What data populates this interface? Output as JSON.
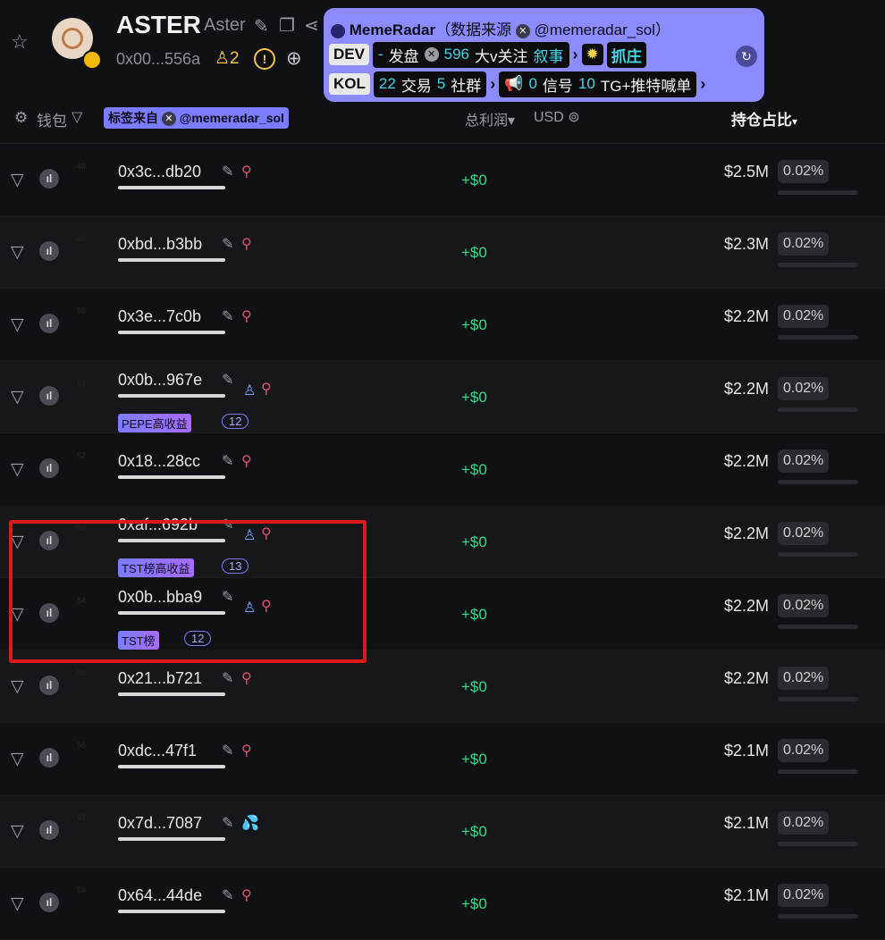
{
  "token": {
    "symbol": "ASTER",
    "name": "Aster",
    "address": "0x00...556a",
    "holders_count": "2"
  },
  "popup": {
    "brand": "MemeRadar",
    "source_label": "（数据来源",
    "source_handle": "@memeradar_sol）",
    "dev": {
      "tag": "DEV",
      "dash": "-",
      "launch": "发盘",
      "follow_count": "596",
      "follow_label": "大v关注",
      "narrative": "叙事",
      "catch": "抓庄"
    },
    "kol": {
      "tag": "KOL",
      "trade_count": "22",
      "trade_label": "交易",
      "group_count": "5",
      "group_label": "社群",
      "signal_count": "0",
      "signal_label": "信号",
      "tg_count": "10",
      "tg_label": "TG+推特喊单"
    }
  },
  "columns": {
    "wallet": "钱包",
    "tag_source": "标签来自",
    "tag_handle": "@memeradar_sol",
    "profit": "总利润",
    "currency": "USD",
    "holding": "持仓占比"
  },
  "rows": [
    {
      "rank": "48",
      "address": "0x3c...db20",
      "profit": "+$0",
      "value": "$2.5M",
      "pct": "0.02%",
      "avatar": "#d9c7a8",
      "tag": "",
      "tag_count": ""
    },
    {
      "rank": "49",
      "address": "0xbd...b3bb",
      "profit": "+$0",
      "value": "$2.3M",
      "pct": "0.02%",
      "avatar": "#a9c9d8",
      "tag": "",
      "tag_count": ""
    },
    {
      "rank": "50",
      "address": "0x3e...7c0b",
      "profit": "+$0",
      "value": "$2.2M",
      "pct": "0.02%",
      "avatar": "#8fc4d8",
      "tag": "",
      "tag_count": ""
    },
    {
      "rank": "51",
      "address": "0x0b...967e",
      "profit": "+$0",
      "value": "$2.2M",
      "pct": "0.02%",
      "avatar": "#b8c8d8",
      "tag": "PEPE高收益",
      "tag_count": "12"
    },
    {
      "rank": "52",
      "address": "0x18...28cc",
      "profit": "+$0",
      "value": "$2.2M",
      "pct": "0.02%",
      "avatar": "#e29aa8",
      "tag": "",
      "tag_count": ""
    },
    {
      "rank": "53",
      "address": "0xaf...692b",
      "profit": "+$0",
      "value": "$2.2M",
      "pct": "0.02%",
      "avatar": "#c8c8d0",
      "tag": "TST榜高收益",
      "tag_count": "13"
    },
    {
      "rank": "54",
      "address": "0x0b...bba9",
      "profit": "+$0",
      "value": "$2.2M",
      "pct": "0.02%",
      "avatar": "#9b8fb5",
      "tag": "TST榜",
      "tag_count": "12"
    },
    {
      "rank": "55",
      "address": "0x21...b721",
      "profit": "+$0",
      "value": "$2.2M",
      "pct": "0.02%",
      "avatar": "#e6d48a",
      "tag": "",
      "tag_count": ""
    },
    {
      "rank": "56",
      "address": "0xdc...47f1",
      "profit": "+$0",
      "value": "$2.1M",
      "pct": "0.02%",
      "avatar": "#b69fd0",
      "tag": "",
      "tag_count": ""
    },
    {
      "rank": "57",
      "address": "0x7d...7087",
      "profit": "+$0",
      "value": "$2.1M",
      "pct": "0.02%",
      "avatar": "#d9a06a",
      "tag": "",
      "tag_count": ""
    },
    {
      "rank": "58",
      "address": "0x64...44de",
      "profit": "+$0",
      "value": "$2.1M",
      "pct": "0.02%",
      "avatar": "#e98fb8",
      "tag": "",
      "tag_count": ""
    }
  ]
}
